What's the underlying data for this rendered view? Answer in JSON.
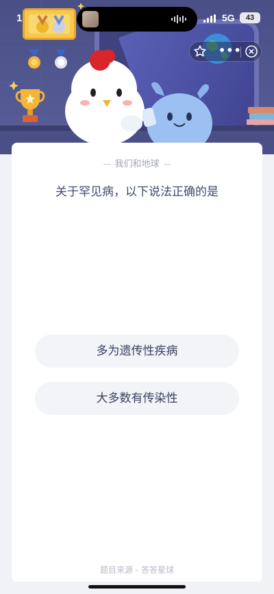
{
  "status_bar": {
    "time": "1",
    "network": "5G",
    "battery": "43"
  },
  "capsule": {
    "more_label": "•••"
  },
  "quiz": {
    "category": "我们和地球",
    "question": "关于罕见病，以下说法正确的是",
    "options": [
      {
        "label": "多为遗传性疾病"
      },
      {
        "label": "大多数有传染性"
      }
    ],
    "source": "题目来源 - 答答星球"
  },
  "colors": {
    "header_bg": "#4f5490",
    "card_bg": "#ffffff",
    "page_bg": "#f1f2f6",
    "option_bg": "#f3f4f7",
    "question_text": "#3f4a6e"
  }
}
